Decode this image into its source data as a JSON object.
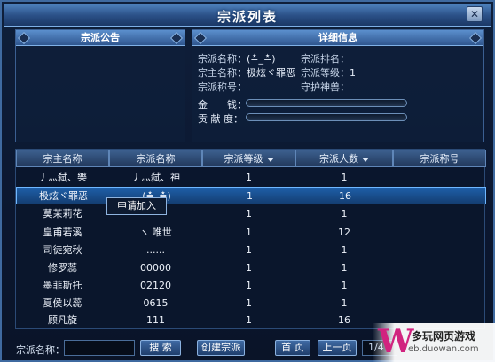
{
  "window": {
    "title": "宗派列表",
    "close_glyph": "✕"
  },
  "notice_panel": {
    "title": "宗派公告"
  },
  "detail_panel": {
    "title": "详细信息",
    "sect_name_label": "宗派名称：",
    "sect_name_value": "(≛_≛)",
    "sect_rank_label": "宗派排名：",
    "sect_rank_value": "",
    "leader_label": "宗主名称：",
    "leader_value": "极炫ヾ罪恶",
    "level_label": "宗派等级：",
    "level_value": "1",
    "title_label": "宗派称号：",
    "title_value": "",
    "beast_label": "守护神兽：",
    "beast_value": "",
    "money_label": "金　　钱：",
    "contribution_label": "贡 献 度："
  },
  "table": {
    "columns": [
      "宗主名称",
      "宗派名称",
      "宗派等级",
      "宗派人数",
      "宗派称号"
    ],
    "rows": [
      {
        "leader": "丿灬弑、樂",
        "sect": "丿灬弑、神",
        "level": "1",
        "members": "1",
        "title": ""
      },
      {
        "leader": "极炫ヾ罪恶",
        "sect": "(≛_≛)",
        "level": "1",
        "members": "16",
        "title": ""
      },
      {
        "leader": "莫茉莉花",
        "sect": "",
        "level": "1",
        "members": "1",
        "title": ""
      },
      {
        "leader": "皇甫若溪",
        "sect": "ヽ 唯世",
        "level": "1",
        "members": "12",
        "title": ""
      },
      {
        "leader": "司徒宛秋",
        "sect": "......",
        "level": "1",
        "members": "1",
        "title": ""
      },
      {
        "leader": "修罗蕊",
        "sect": "00000",
        "level": "1",
        "members": "1",
        "title": ""
      },
      {
        "leader": "墨菲斯托",
        "sect": "02120",
        "level": "1",
        "members": "1",
        "title": ""
      },
      {
        "leader": "夏侯以蕊",
        "sect": "0615",
        "level": "1",
        "members": "1",
        "title": ""
      },
      {
        "leader": "顾凡旋",
        "sect": "111",
        "level": "1",
        "members": "16",
        "title": ""
      }
    ]
  },
  "context_menu": {
    "join_label": "申请加入"
  },
  "bottom": {
    "search_label": "宗派名称：",
    "search_value": "",
    "search_button": "搜 索",
    "create_button": "创建宗派",
    "first_page_button": "首 页",
    "prev_page_button": "上一页",
    "page_indicator": "1/4"
  },
  "watermark": {
    "logo": "W",
    "title": "多玩网页游戏",
    "url": "eb.duowan.com"
  },
  "colors": {
    "accent": "#4f83bf",
    "selected_row": "#1e5fa8",
    "watermark_logo": "#d1237f"
  }
}
